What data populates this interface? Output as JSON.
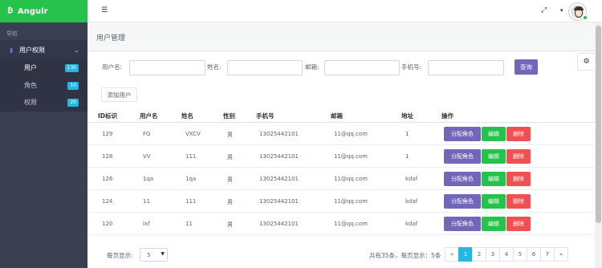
{
  "brand": {
    "name": "Angulr",
    "logo": "₿"
  },
  "sidebar": {
    "section": "导航",
    "group": "用户权限",
    "items": [
      {
        "label": "用户",
        "badge": "130"
      },
      {
        "label": "角色",
        "badge": "10"
      },
      {
        "label": "权限",
        "badge": "20"
      }
    ]
  },
  "header": {
    "menu_icon": "☰",
    "expand_icon": "⤢",
    "dropdown_icon": "▾"
  },
  "page": {
    "title": "用户管理"
  },
  "search": {
    "username_label": "用户名:",
    "name_label": "姓名:",
    "email_label": "邮箱:",
    "phone_label": "手机号:",
    "query_button": "查询",
    "add_button": "添加用户"
  },
  "table": {
    "headers": [
      "ID标识",
      "用户名",
      "姓名",
      "性别",
      "手机号",
      "邮箱",
      "地址",
      "操作"
    ],
    "rows": [
      {
        "id": "129",
        "username": "FG",
        "name": "VXCV",
        "gender": "男",
        "phone": "13025442101",
        "email": "11@qq.com",
        "address": "1"
      },
      {
        "id": "128",
        "username": "VV",
        "name": "111",
        "gender": "男",
        "phone": "13025442101",
        "email": "11@qq.com",
        "address": "1"
      },
      {
        "id": "126",
        "username": "1qa",
        "name": "1qa",
        "gender": "男",
        "phone": "13025442101",
        "email": "11@qq.com",
        "address": "kdaf"
      },
      {
        "id": "124",
        "username": "11",
        "name": "111",
        "gender": "男",
        "phone": "13025442101",
        "email": "11@qq.com",
        "address": "kdaf"
      },
      {
        "id": "120",
        "username": "lxf",
        "name": "11",
        "gender": "男",
        "phone": "13025442101",
        "email": "11@qq.com",
        "address": "kdaf"
      }
    ],
    "actions": {
      "role": "分配角色",
      "edit": "编辑",
      "delete": "删除"
    }
  },
  "footer": {
    "page_size_label": "每页显示:",
    "page_size": "5",
    "summary": "共有35条，每页显示：5条",
    "prev": "«",
    "pages": [
      "1",
      "2",
      "3",
      "4",
      "5",
      "6",
      "7"
    ],
    "next": "»",
    "current_page": "1"
  },
  "colors": {
    "brand": "#27c24c",
    "primary": "#7266ba",
    "success": "#27c24c",
    "danger": "#f05050",
    "info": "#23b7e5",
    "sidebar": "#3a3f51"
  }
}
